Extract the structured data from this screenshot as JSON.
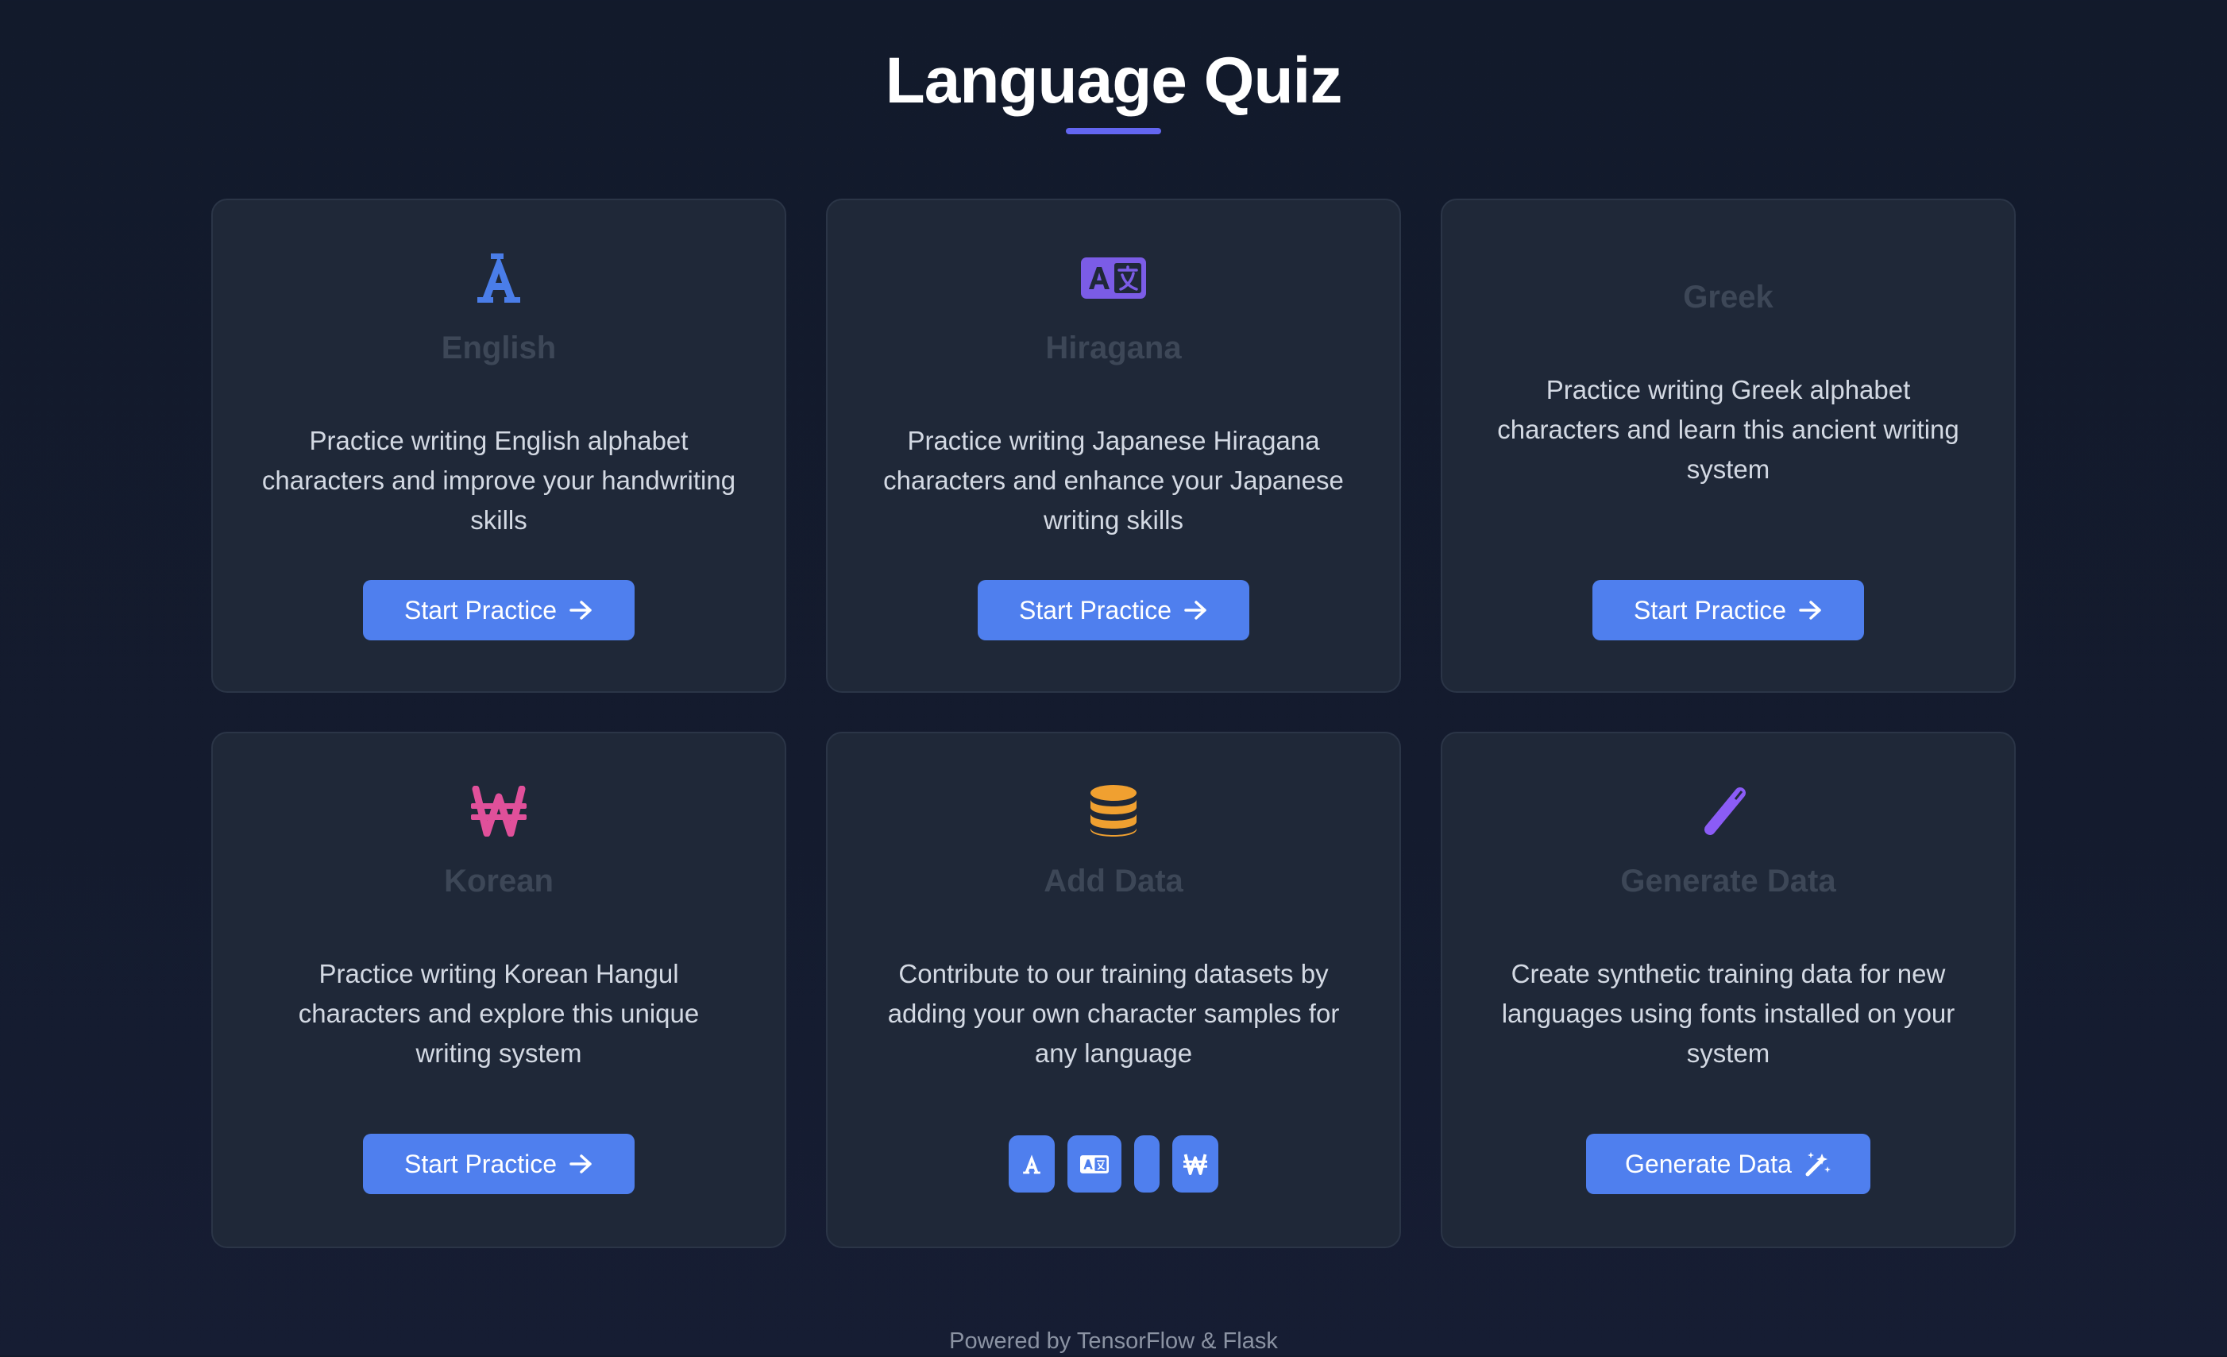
{
  "page": {
    "title": "Language Quiz",
    "footer": "Powered by TensorFlow & Flask"
  },
  "cards": [
    {
      "title": "English",
      "icon": "letter-a-icon",
      "icon_color": "#4a7de8",
      "description": "Practice writing English alphabet characters and improve your handwriting skills",
      "button_label": "Start Practice"
    },
    {
      "title": "Hiragana",
      "icon": "translate-icon",
      "icon_color": "#7b5ce6",
      "description": "Practice writing Japanese Hiragana characters and enhance your Japanese writing skills",
      "button_label": "Start Practice"
    },
    {
      "title": "Greek",
      "icon": "",
      "description": "Practice writing Greek alphabet characters and learn this ancient writing system",
      "button_label": "Start Practice"
    },
    {
      "title": "Korean",
      "icon": "won-sign-icon",
      "icon_color": "#e0509a",
      "description": "Practice writing Korean Hangul characters and explore this unique writing system",
      "button_label": "Start Practice"
    },
    {
      "title": "Add Data",
      "icon": "database-icon",
      "icon_color": "#f0a030",
      "description": "Contribute to our training datasets by adding your own character samples for any language",
      "language_buttons": [
        "letter-a-icon",
        "translate-icon",
        "empty",
        "won-sign-icon"
      ]
    },
    {
      "title": "Generate Data",
      "icon": "magic-wand-icon",
      "icon_color": "#8b5cf6",
      "description": "Create synthetic training data for new languages using fonts installed on your system",
      "button_label": "Generate Data"
    }
  ],
  "colors": {
    "accent": "#4f7fee",
    "underline": "#6366f1",
    "card_bg": "#1f2838",
    "page_bg": "#131a2b"
  }
}
